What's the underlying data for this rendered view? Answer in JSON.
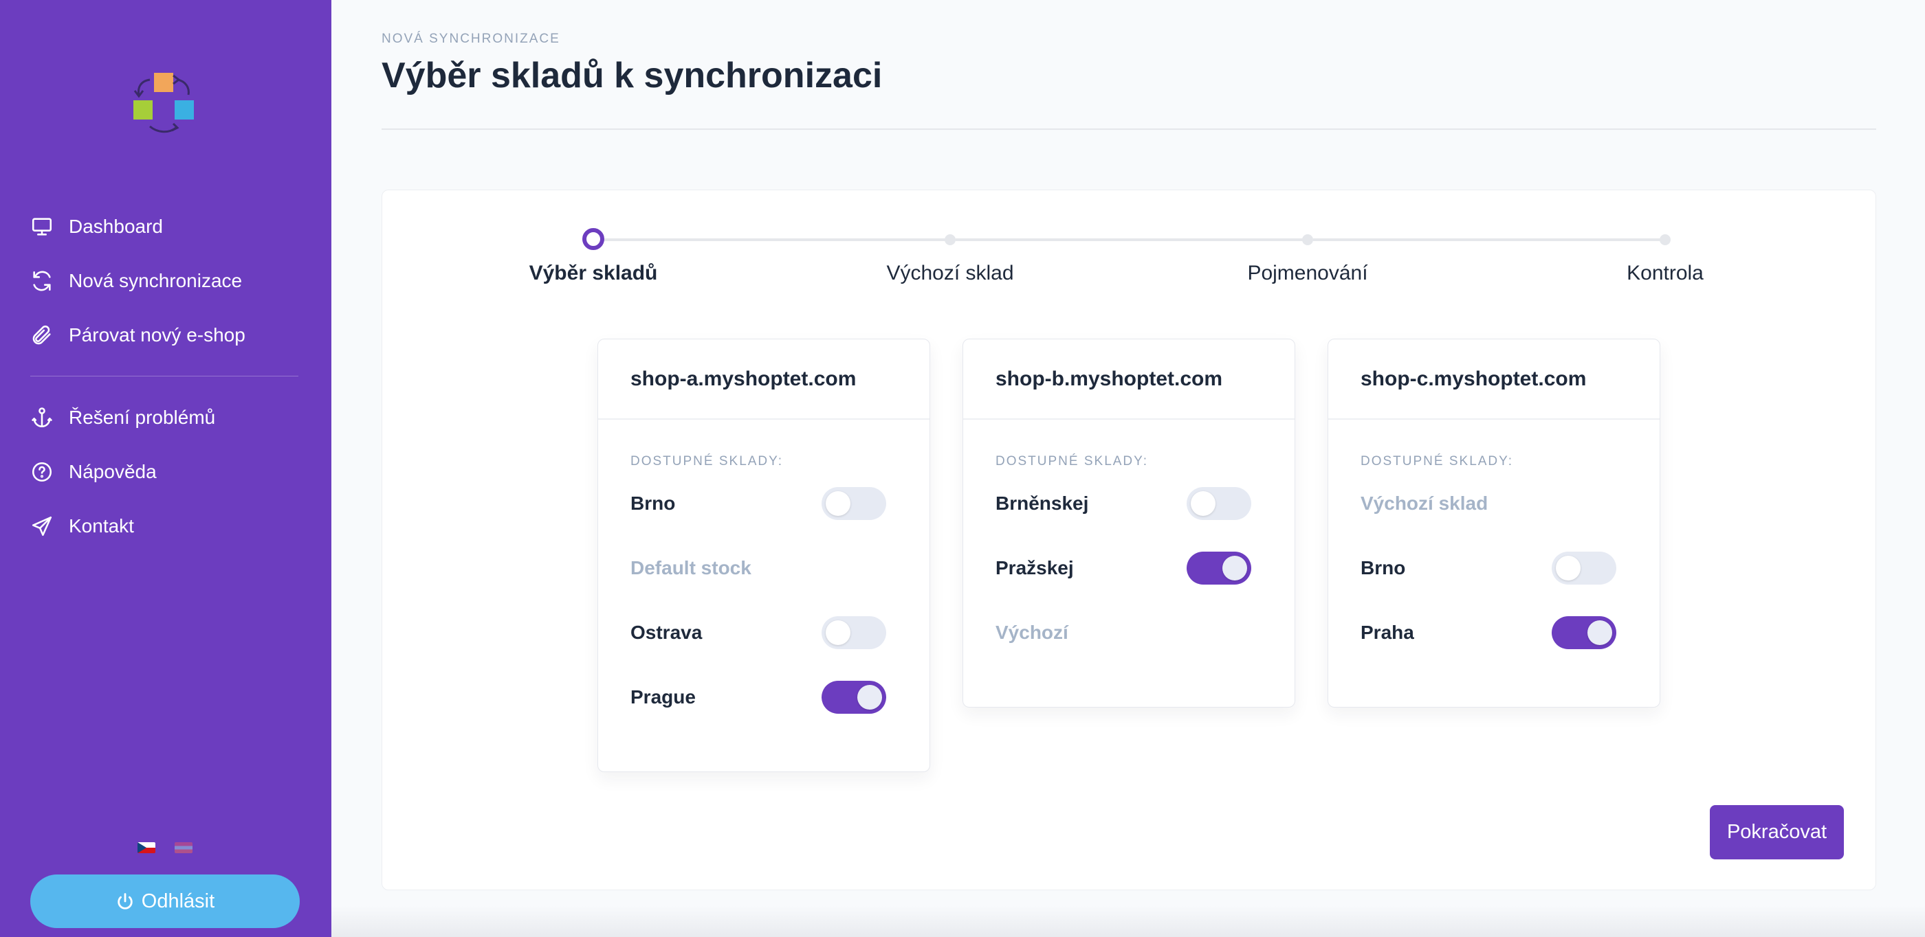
{
  "sidebar": {
    "nav": [
      {
        "label": "Dashboard",
        "icon": "monitor-icon"
      },
      {
        "label": "Nová synchronizace",
        "icon": "sync-icon"
      },
      {
        "label": "Párovat nový e-shop",
        "icon": "paperclip-icon"
      }
    ],
    "nav_secondary": [
      {
        "label": "Řešení problémů",
        "icon": "anchor-icon"
      },
      {
        "label": "Nápověda",
        "icon": "help-circle-icon"
      },
      {
        "label": "Kontakt",
        "icon": "send-icon"
      }
    ],
    "languages": [
      "cz-flag-icon",
      "en-flag-icon"
    ],
    "logout_label": "Odhlásit"
  },
  "header": {
    "subtitle": "NOVÁ SYNCHRONIZACE",
    "title": "Výběr skladů k synchronizaci"
  },
  "stepper": {
    "steps": [
      "Výběr skladů",
      "Výchozí sklad",
      "Pojmenování",
      "Kontrola"
    ],
    "active_index": 0
  },
  "available_label": "DOSTUPNÉ SKLADY:",
  "shops": [
    {
      "name": "shop-a.myshoptet.com",
      "stocks": [
        {
          "name": "Brno",
          "enabled": false,
          "disabled": false
        },
        {
          "name": "Default stock",
          "enabled": null,
          "disabled": true
        },
        {
          "name": "Ostrava",
          "enabled": false,
          "disabled": false
        },
        {
          "name": "Prague",
          "enabled": true,
          "disabled": false
        }
      ]
    },
    {
      "name": "shop-b.myshoptet.com",
      "stocks": [
        {
          "name": "Brněnskej",
          "enabled": false,
          "disabled": false
        },
        {
          "name": "Pražskej",
          "enabled": true,
          "disabled": false
        },
        {
          "name": "Výchozí",
          "enabled": null,
          "disabled": true
        }
      ]
    },
    {
      "name": "shop-c.myshoptet.com",
      "stocks": [
        {
          "name": "Výchozí sklad",
          "enabled": null,
          "disabled": true
        },
        {
          "name": "Brno",
          "enabled": false,
          "disabled": false
        },
        {
          "name": "Praha",
          "enabled": true,
          "disabled": false
        }
      ]
    }
  ],
  "continue_label": "Pokračovat",
  "colors": {
    "sidebar": "#6c3dbf",
    "accent": "#6c3dbf",
    "logout": "#56b7ee",
    "muted_text": "#94a3b8"
  }
}
